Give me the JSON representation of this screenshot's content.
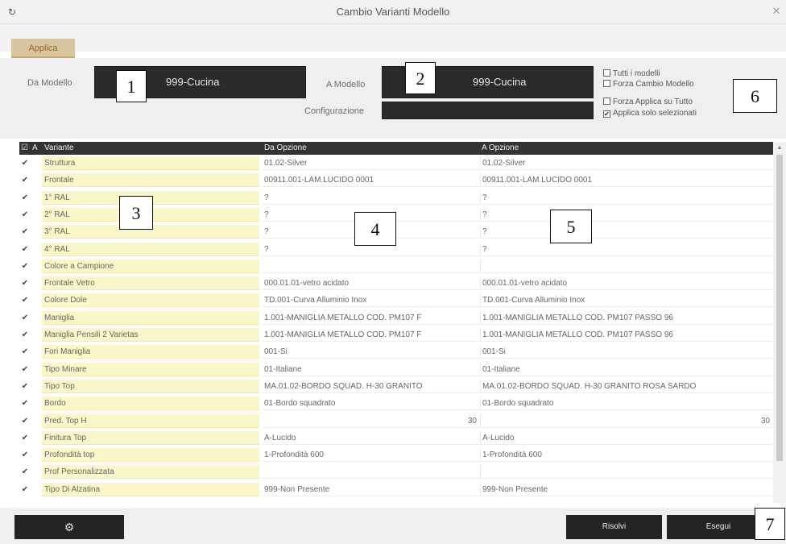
{
  "window": {
    "title": "Cambio Varianti Modello",
    "app_icon": "app-icon",
    "close_icon": "close-icon"
  },
  "tabs": {
    "applica": "Applica"
  },
  "header": {
    "da_modello_label": "Da Modello",
    "da_modello_value": "999-Cucina",
    "a_modello_label": "A Modello",
    "a_modello_value": "999-Cucina",
    "configurazione_label": "Configurazione",
    "configurazione_value": ""
  },
  "options": {
    "tutti_modelli": {
      "label": "Tutti i modelli",
      "checked": false
    },
    "forza_cambio": {
      "label": "Forza Cambio Modello",
      "checked": false
    },
    "forza_applica": {
      "label": "Forza Applica su Tutto",
      "checked": false
    },
    "applica_selezionati": {
      "label": "Applica solo selezionati",
      "checked": true
    }
  },
  "grid": {
    "headers": {
      "check": "☑",
      "a": "A",
      "variante": "Variante",
      "da_opzione": "Da Opzione",
      "a_opzione": "A Opzione"
    },
    "rows": [
      {
        "checked": true,
        "variante": "Struttura",
        "da": "01.02-Silver",
        "a": "01.02-Silver"
      },
      {
        "checked": true,
        "variante": "Frontale",
        "da": "00911.001-LAM.LUCIDO 0001",
        "a": "00911.001-LAM.LUCIDO 0001"
      },
      {
        "checked": true,
        "variante": "1° RAL",
        "da": "?",
        "a": "?"
      },
      {
        "checked": true,
        "variante": "2° RAL",
        "da": "?",
        "a": "?"
      },
      {
        "checked": true,
        "variante": "3° RAL",
        "da": "?",
        "a": "?"
      },
      {
        "checked": true,
        "variante": "4° RAL",
        "da": "?",
        "a": "?"
      },
      {
        "checked": true,
        "variante": "Colore a Campione",
        "da": "",
        "a": ""
      },
      {
        "checked": true,
        "variante": "Frontale Vetro",
        "da": "000.01.01-vetro acidato",
        "a": "000.01.01-vetro acidato"
      },
      {
        "checked": true,
        "variante": "Colore Dole",
        "da": "TD.001-Curva Alluminio Inox",
        "a": "TD.001-Curva Alluminio Inox"
      },
      {
        "checked": true,
        "variante": "Maniglia",
        "da": "1.001-MANIGLIA METALLO COD. PM107 F",
        "a": "1.001-MANIGLIA METALLO COD. PM107 PASSO 96"
      },
      {
        "checked": true,
        "variante": "Maniglia Pensili 2 Varietas",
        "da": "1.001-MANIGLIA METALLO COD. PM107 F",
        "a": "1.001-MANIGLIA METALLO COD. PM107 PASSO 96"
      },
      {
        "checked": true,
        "variante": "Fori Maniglia",
        "da": "001-Si",
        "a": "001-Si"
      },
      {
        "checked": true,
        "variante": "Tipo Minare",
        "da": "01-Italiane",
        "a": "01-Italiane"
      },
      {
        "checked": true,
        "variante": "Tipo Top",
        "da": "MA.01.02-BORDO SQUAD. H-30 GRANITO",
        "a": "MA.01.02-BORDO SQUAD. H-30 GRANITO ROSA SARDO"
      },
      {
        "checked": true,
        "variante": "Bordo",
        "da": "01-Bordo squadrato",
        "a": "01-Bordo squadrato"
      },
      {
        "checked": true,
        "variante": "Pred. Top H",
        "da": "30",
        "a": "30",
        "numeric": true
      },
      {
        "checked": true,
        "variante": "Finitura Top",
        "da": "A-Lucido",
        "a": "A-Lucido"
      },
      {
        "checked": true,
        "variante": "Profondità top",
        "da": "1-Profondità 600",
        "a": "1-Profondità 600"
      },
      {
        "checked": true,
        "variante": "Prof Personalizzata",
        "da": "",
        "a": ""
      },
      {
        "checked": true,
        "variante": "Tipo Di Alzatina",
        "da": "999-Non Presente",
        "a": "999-Non Presente"
      }
    ]
  },
  "footer": {
    "settings_icon": "gear-icon",
    "risolvi_label": "Risolvi",
    "esegui_label": "Esegui"
  },
  "callouts": [
    "1",
    "2",
    "3",
    "4",
    "5",
    "6",
    "7"
  ]
}
